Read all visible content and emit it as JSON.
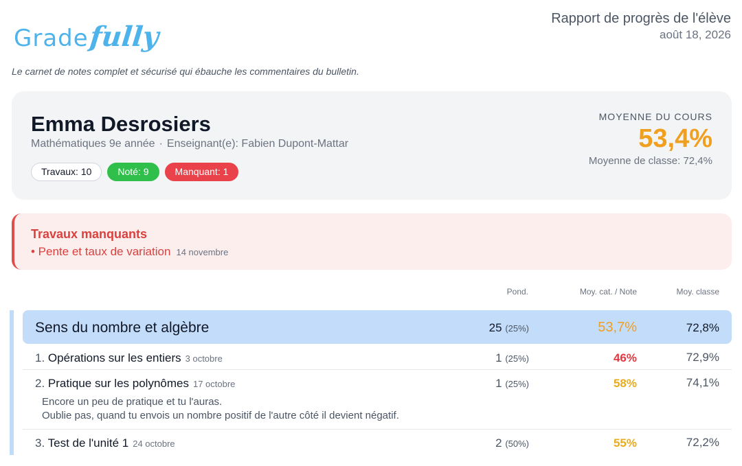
{
  "logo": {
    "part1": "Grade",
    "part2": "fully"
  },
  "tagline": "Le carnet de notes complet et sécurisé qui ébauche les commentaires du bulletin.",
  "report": {
    "title": "Rapport de progrès de l'élève",
    "date": "août 18, 2026"
  },
  "student": {
    "name": "Emma Desrosiers",
    "course": "Mathématiques 9e année",
    "separator": "·",
    "teacher": "Enseignant(e): Fabien Dupont-Mattar",
    "pills": {
      "total": "Travaux: 10",
      "graded": "Noté: 9",
      "missing": "Manquant: 1"
    },
    "average_label": "MOYENNE DU COURS",
    "average_value": "53,4%",
    "class_average": "Moyenne de classe: 72,4%"
  },
  "missing": {
    "title": "Travaux manquants",
    "items": [
      {
        "name": "• Pente et taux de variation",
        "date": "14 novembre"
      }
    ]
  },
  "columns": {
    "weight": "Pond.",
    "cat_grade": "Moy. cat. / Note",
    "class_avg": "Moy. classe"
  },
  "category": {
    "name": "Sens du nombre et algèbre",
    "weight": "25",
    "weight_pct": "(25%)",
    "score": "53,7%",
    "class_avg": "72,8%"
  },
  "assignments": [
    {
      "num": "1.",
      "name": "Opérations sur les entiers",
      "date": "3 octobre",
      "weight": "1",
      "weight_pct": "(25%)",
      "score": "46%",
      "score_color": "#e2383f",
      "class_avg": "72,9%",
      "comment": []
    },
    {
      "num": "2.",
      "name": "Pratique sur les polynômes",
      "date": "17 octobre",
      "weight": "1",
      "weight_pct": "(25%)",
      "score": "58%",
      "score_color": "#e9ab1c",
      "class_avg": "74,1%",
      "comment": [
        "Encore un peu de pratique et tu l'auras.",
        "Oublie pas, quand tu envois un nombre positif de l'autre côté il devient négatif."
      ]
    },
    {
      "num": "3.",
      "name": "Test de l'unité 1",
      "date": "24 octobre",
      "weight": "2",
      "weight_pct": "(50%)",
      "score": "55%",
      "score_color": "#e9ab1c",
      "class_avg": "72,2%",
      "comment": []
    }
  ]
}
